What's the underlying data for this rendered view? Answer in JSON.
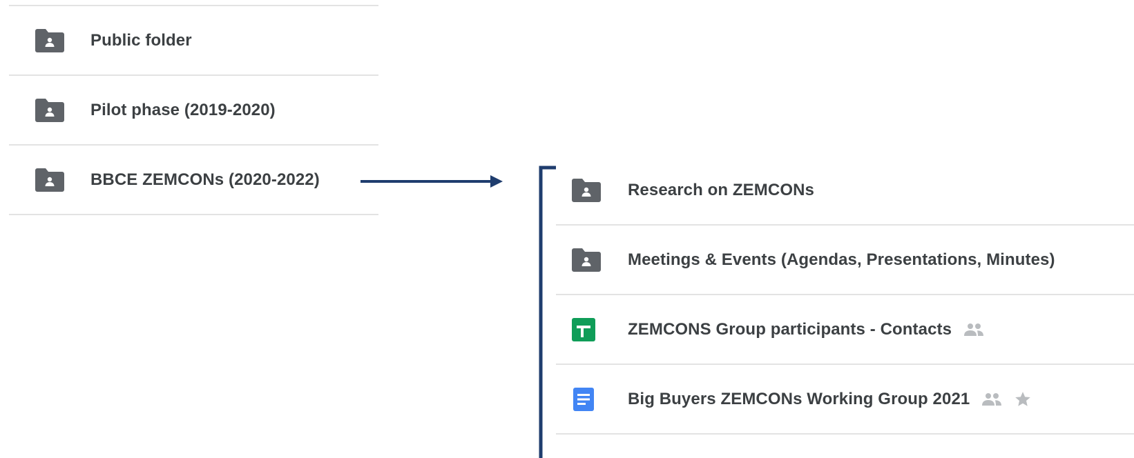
{
  "left_list": {
    "items": [
      {
        "label": "Public folder",
        "icon": "shared-folder-icon"
      },
      {
        "label": "Pilot phase (2019-2020)",
        "icon": "shared-folder-icon"
      },
      {
        "label": "BBCE ZEMCONs (2020-2022)",
        "icon": "shared-folder-icon"
      }
    ]
  },
  "right_list": {
    "items": [
      {
        "label": "Research on ZEMCONs",
        "icon": "shared-folder-icon"
      },
      {
        "label": "Meetings & Events (Agendas, Presentations, Minutes)",
        "icon": "shared-folder-icon"
      },
      {
        "label": "ZEMCONS Group participants - Contacts",
        "icon": "google-sheets-icon",
        "shared": true
      },
      {
        "label": "Big Buyers ZEMCONs Working Group 2021",
        "icon": "google-docs-icon",
        "shared": true,
        "starred": true
      }
    ]
  },
  "colors": {
    "folder_icon": "#5f6368",
    "sheets_green": "#0f9d58",
    "docs_blue": "#4285f4",
    "text": "#3c4043",
    "muted_icon": "#b9bcbf",
    "connector_navy": "#1f3d6e",
    "divider": "#e3e3e3"
  }
}
